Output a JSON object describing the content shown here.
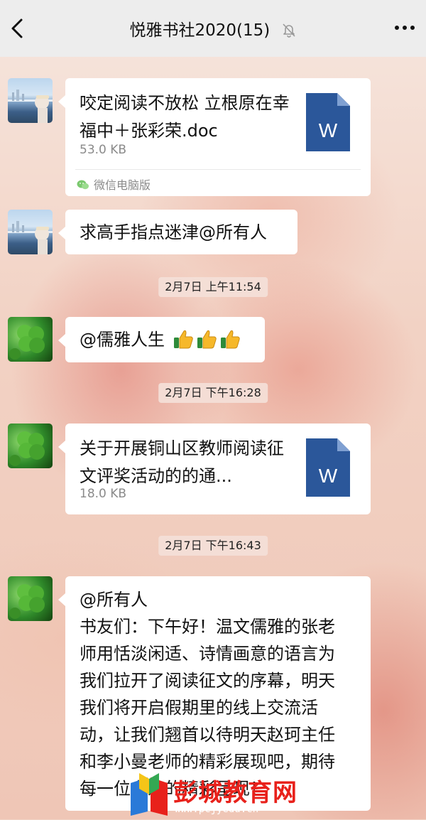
{
  "header": {
    "title": "悦雅书社2020(15)",
    "back_icon": "back-arrow-icon",
    "mute_icon": "bell-muted-icon",
    "more_icon": "more-dots-icon"
  },
  "messages": [
    {
      "type": "file",
      "avatar": "seaside-photo-avatar",
      "file_name": "咬定阅读不放松 立根原在幸福中＋张彩荣.doc",
      "file_size": "53.0 KB",
      "source": "微信电脑版"
    },
    {
      "type": "text",
      "avatar": "seaside-photo-avatar",
      "text": "求高手指点迷津@所有人"
    },
    {
      "type": "timestamp",
      "text": "2月7日 上午11:54"
    },
    {
      "type": "text",
      "avatar": "clover-avatar",
      "text": "@儒雅人生",
      "emoji": [
        "thumbs-up",
        "thumbs-up",
        "thumbs-up"
      ]
    },
    {
      "type": "timestamp",
      "text": "2月7日 下午16:28"
    },
    {
      "type": "file",
      "avatar": "clover-avatar",
      "file_name": "关于开展铜山区教师阅读征文评奖活动的的通...",
      "file_size": "18.0 KB"
    },
    {
      "type": "timestamp",
      "text": "2月7日 下午16:43"
    },
    {
      "type": "text",
      "avatar": "clover-avatar",
      "lines": [
        "@所有人",
        "书友们：下午好！温文儒雅的张老",
        "师用恬淡闲适、诗情画意的语言为",
        "我们拉开了阅读征文的序幕，明天",
        "我们将开启假期里的线上交流活",
        "动，让我们翘首以待明天赵珂主任",
        "和李小曼老师的精彩展现吧，期待",
        "每一位书友的精彩呈现！"
      ]
    }
  ],
  "watermark": {
    "text": "彭城教育网",
    "url": "www.pcjyedu.cn"
  },
  "colors": {
    "header_bg": "#ededed",
    "bubble_bg": "#ffffff",
    "word_icon": "#2b579a",
    "watermark_red": "#e8211b"
  }
}
